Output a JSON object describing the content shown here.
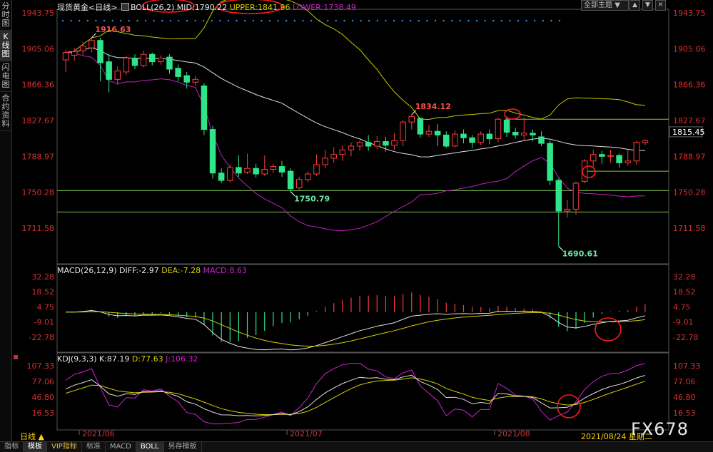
{
  "sidebar": {
    "items": [
      {
        "label": "分时图",
        "active": false
      },
      {
        "label": "K线图",
        "active": true
      },
      {
        "label": "闪电图",
        "active": false
      },
      {
        "label": "合约资料",
        "active": false
      }
    ]
  },
  "header": {
    "instrument": "现货黄金",
    "period_tag": "<日线>",
    "boll_label": "BOLL(26,2)",
    "mid_label": "MID:1790.22",
    "upper_label": "UPPER:1841.96",
    "lower_label": "LOWER:1738.49",
    "theme_select": "全部主题",
    "theme_arrow": "▼"
  },
  "window_controls": [
    "▲",
    "▼",
    "✕"
  ],
  "price_axis": {
    "left_ticks": [
      "1943.75",
      "1905.06",
      "1866.36",
      "1827.67",
      "1788.97",
      "1750.28",
      "1711.58"
    ],
    "right_ticks": [
      "1943.75",
      "1905.06",
      "1866.36",
      "1827.67",
      "1788.97",
      "1750.28",
      "1711.58"
    ],
    "current_price": "1815.45"
  },
  "annotations": {
    "high_1": "1916.63",
    "low_1": "1750.79",
    "high_2": "1834.12",
    "low_2": "1690.61"
  },
  "macd": {
    "label": "MACD(26,12,9)",
    "diff": "DIFF:-2.97",
    "dea": "DEA:-7.28",
    "macd": "MACD:8.63",
    "ticks": [
      "32.28",
      "18.52",
      "4.75",
      "-9.01",
      "-22.78"
    ]
  },
  "kdj": {
    "label": "KDJ(9,3,3)",
    "k": "K:87.19",
    "d": "D:77.63",
    "j": "J:106.32",
    "ticks": [
      "107.33",
      "77.06",
      "46.80",
      "16.53"
    ]
  },
  "time_axis": {
    "labels": [
      "2021/06",
      "2021/07",
      "2021/08"
    ],
    "period_label": "日线 ▲",
    "date_stamp": "2021/08/24 星期二"
  },
  "bottom_tabs": [
    {
      "label": "指标",
      "active": false
    },
    {
      "label": "模板",
      "active": true
    },
    {
      "label": "VIP指标",
      "active": false
    },
    {
      "label": "标准",
      "active": false
    },
    {
      "label": "MACD",
      "active": false
    },
    {
      "label": "BOLL",
      "active": true
    },
    {
      "label": "另存模板",
      "active": false
    }
  ],
  "watermark": "FX678",
  "colors": {
    "up": "#ff3b3b",
    "down": "#2ee58a",
    "mid": "#e0e0e0",
    "upper": "#c8c800",
    "lower": "#c020c0",
    "diff": "#e0e0e0",
    "dea": "#d8d000",
    "j_line": "#d020d0",
    "hline": "#80c850",
    "annotation_circle": "#ff1a1a",
    "axis_text": "#d83030"
  },
  "chart_data": {
    "type": "candlestick",
    "title": "现货黄金 <日线>",
    "ylim": [
      1690,
      1945
    ],
    "candles": [
      [
        1893,
        1901,
        1880,
        1904
      ],
      [
        1898,
        1902,
        1892,
        1906
      ],
      [
        1903,
        1908,
        1898,
        1913
      ],
      [
        1906,
        1914,
        1901,
        1917
      ],
      [
        1914,
        1890,
        1870,
        1917
      ],
      [
        1891,
        1872,
        1858,
        1899
      ],
      [
        1872,
        1881,
        1866,
        1886
      ],
      [
        1880,
        1895,
        1877,
        1897
      ],
      [
        1895,
        1887,
        1883,
        1899
      ],
      [
        1887,
        1899,
        1885,
        1903
      ],
      [
        1899,
        1891,
        1887,
        1901
      ],
      [
        1891,
        1895,
        1888,
        1898
      ],
      [
        1896,
        1883,
        1878,
        1899
      ],
      [
        1884,
        1875,
        1870,
        1888
      ],
      [
        1876,
        1869,
        1862,
        1880
      ],
      [
        1869,
        1872,
        1865,
        1876
      ],
      [
        1865,
        1818,
        1812,
        1868
      ],
      [
        1818,
        1771,
        1765,
        1822
      ],
      [
        1771,
        1763,
        1760,
        1776
      ],
      [
        1763,
        1777,
        1761,
        1780
      ],
      [
        1777,
        1771,
        1767,
        1790
      ],
      [
        1772,
        1776,
        1770,
        1792
      ],
      [
        1776,
        1770,
        1766,
        1781
      ],
      [
        1770,
        1775,
        1768,
        1790
      ],
      [
        1775,
        1778,
        1771,
        1781
      ],
      [
        1778,
        1772,
        1767,
        1784
      ],
      [
        1773,
        1754,
        1751,
        1776
      ],
      [
        1755,
        1764,
        1752,
        1767
      ],
      [
        1764,
        1770,
        1761,
        1773
      ],
      [
        1770,
        1780,
        1768,
        1791
      ],
      [
        1780,
        1787,
        1776,
        1796
      ],
      [
        1787,
        1791,
        1782,
        1799
      ],
      [
        1791,
        1796,
        1784,
        1801
      ],
      [
        1796,
        1800,
        1789,
        1804
      ],
      [
        1800,
        1804,
        1795,
        1806
      ],
      [
        1804,
        1800,
        1795,
        1812
      ],
      [
        1800,
        1805,
        1797,
        1811
      ],
      [
        1805,
        1801,
        1794,
        1810
      ],
      [
        1801,
        1806,
        1796,
        1814
      ],
      [
        1806,
        1826,
        1800,
        1828
      ],
      [
        1826,
        1832,
        1818,
        1834
      ],
      [
        1830,
        1813,
        1809,
        1831
      ],
      [
        1813,
        1816,
        1810,
        1823
      ],
      [
        1816,
        1812,
        1800,
        1824
      ],
      [
        1812,
        1800,
        1798,
        1816
      ],
      [
        1800,
        1813,
        1799,
        1817
      ],
      [
        1813,
        1809,
        1803,
        1818
      ],
      [
        1809,
        1804,
        1798,
        1812
      ],
      [
        1804,
        1813,
        1801,
        1816
      ],
      [
        1813,
        1808,
        1802,
        1818
      ],
      [
        1808,
        1829,
        1804,
        1831
      ],
      [
        1828,
        1815,
        1810,
        1832
      ],
      [
        1815,
        1812,
        1808,
        1820
      ],
      [
        1812,
        1814,
        1807,
        1831
      ],
      [
        1814,
        1812,
        1805,
        1818
      ],
      [
        1810,
        1803,
        1800,
        1816
      ],
      [
        1803,
        1763,
        1758,
        1806
      ],
      [
        1763,
        1730,
        1692,
        1765
      ],
      [
        1730,
        1732,
        1723,
        1742
      ],
      [
        1732,
        1760,
        1726,
        1762
      ],
      [
        1762,
        1784,
        1760,
        1786
      ],
      [
        1784,
        1791,
        1778,
        1796
      ],
      [
        1791,
        1789,
        1781,
        1795
      ],
      [
        1789,
        1790,
        1782,
        1796
      ],
      [
        1790,
        1782,
        1777,
        1792
      ],
      [
        1782,
        1784,
        1779,
        1796
      ],
      [
        1784,
        1804,
        1780,
        1806
      ],
      [
        1804,
        1806,
        1801,
        1807
      ]
    ],
    "boll": {
      "mid": 1790.22,
      "upper": 1841.96,
      "lower": 1738.49
    },
    "hlines": [
      1829,
      1773,
      1752,
      1729
    ],
    "macd_ylim": [
      -30,
      40
    ],
    "kdj_ylim": [
      -5,
      115
    ]
  }
}
